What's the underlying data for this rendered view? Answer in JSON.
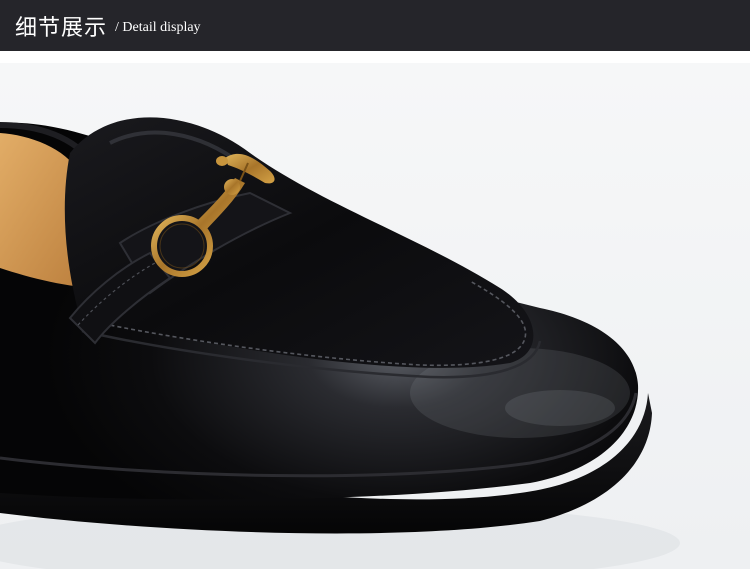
{
  "header": {
    "title_cn": "细节展示",
    "title_en": "/ Detail display"
  },
  "photo": {
    "subject": "shoe-photo",
    "colors": {
      "background": "#f4f5f6",
      "leather": "#0c0c0e",
      "lining": "#d49a52",
      "hardware": "#b8862f"
    }
  }
}
